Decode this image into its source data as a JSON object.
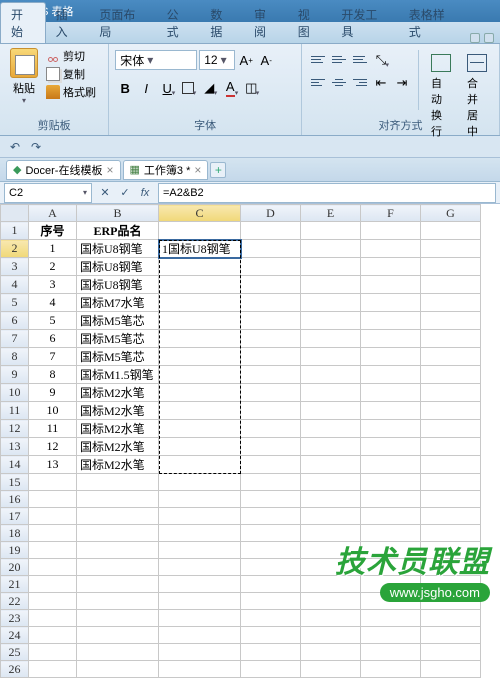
{
  "titlebar": {
    "app": "WPS 表格"
  },
  "tabs": {
    "items": [
      "开始",
      "插入",
      "页面布局",
      "公式",
      "数据",
      "审阅",
      "视图",
      "开发工具",
      "表格样式"
    ],
    "active": 0
  },
  "ribbon": {
    "clipboard": {
      "paste": "粘贴",
      "cut": "剪切",
      "copy": "复制",
      "format_painter": "格式刷",
      "group": "剪贴板"
    },
    "font": {
      "name": "宋体",
      "size": "12",
      "group": "字体"
    },
    "align": {
      "wrap": "自动换行",
      "merge": "合并居中",
      "group": "对齐方式"
    }
  },
  "doctabs": {
    "tab1": "Docer-在线模板",
    "tab2": "工作簿3 *"
  },
  "formula": {
    "name_box": "C2",
    "content": "=A2&B2"
  },
  "grid": {
    "columns": [
      "A",
      "B",
      "C",
      "D",
      "E",
      "F",
      "G"
    ],
    "header_row": {
      "a": "序号",
      "b": "ERP品名"
    },
    "rows": [
      {
        "a": "1",
        "b": "国标U8钢笔",
        "c": "1国标U8钢笔"
      },
      {
        "a": "2",
        "b": "国标U8钢笔",
        "c": ""
      },
      {
        "a": "3",
        "b": "国标U8钢笔",
        "c": ""
      },
      {
        "a": "4",
        "b": "国标M7水笔",
        "c": ""
      },
      {
        "a": "5",
        "b": "国标M5笔芯",
        "c": ""
      },
      {
        "a": "6",
        "b": "国标M5笔芯",
        "c": ""
      },
      {
        "a": "7",
        "b": "国标M5笔芯",
        "c": ""
      },
      {
        "a": "8",
        "b": "国标M1.5钢笔",
        "c": ""
      },
      {
        "a": "9",
        "b": "国标M2水笔",
        "c": ""
      },
      {
        "a": "10",
        "b": "国标M2水笔",
        "c": ""
      },
      {
        "a": "11",
        "b": "国标M2水笔",
        "c": ""
      },
      {
        "a": "12",
        "b": "国标M2水笔",
        "c": ""
      },
      {
        "a": "13",
        "b": "国标M2水笔",
        "c": ""
      }
    ],
    "blank_rows": 12,
    "selected_cell": "C2",
    "marquee_range": "C2:C14"
  },
  "watermark": {
    "line1": "技术员联盟",
    "line2": "www.jsgho.com"
  }
}
